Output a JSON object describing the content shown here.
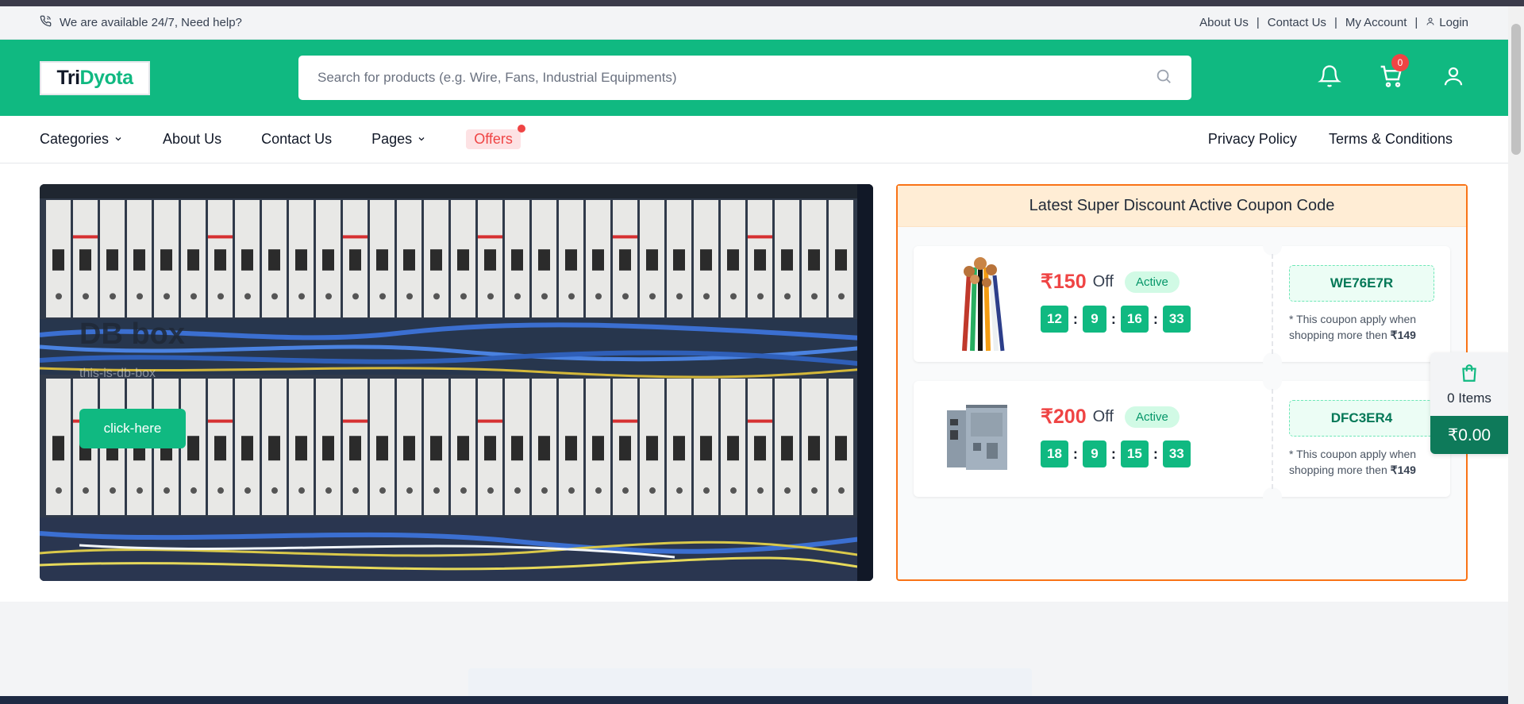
{
  "topbar": {
    "support_text": "We are available 24/7, Need help?",
    "links": [
      "About Us",
      "Contact Us",
      "My Account"
    ],
    "login": "Login"
  },
  "header": {
    "logo_part1": "Tri",
    "logo_part2": "Dyota",
    "search_placeholder": "Search for products (e.g. Wire, Fans, Industrial Equipments)",
    "cart_count": "0",
    "icons": [
      "bell-icon",
      "cart-icon",
      "user-icon"
    ]
  },
  "nav": {
    "categories": "Categories",
    "about": "About Us",
    "contact": "Contact Us",
    "pages": "Pages",
    "offers": "Offers",
    "privacy": "Privacy Policy",
    "terms": "Terms & Conditions"
  },
  "banner": {
    "title": "DB box",
    "subtitle": "this-is-db-box",
    "button": "click-here"
  },
  "coupons": {
    "heading": "Latest Super Discount Active Coupon Code",
    "items": [
      {
        "amount": "₹150",
        "off": "Off",
        "status": "Active",
        "timer": [
          "12",
          "9",
          "16",
          "33"
        ],
        "code": "WE76E7R",
        "note": "* This coupon apply when shopping more then",
        "min": "₹149"
      },
      {
        "amount": "₹200",
        "off": "Off",
        "status": "Active",
        "timer": [
          "18",
          "9",
          "15",
          "33"
        ],
        "code": "DFC3ER4",
        "note": "* This coupon apply when shopping more then",
        "min": "₹149"
      }
    ]
  },
  "cart_widget": {
    "items": "0 Items",
    "total": "₹0.00"
  },
  "colors": {
    "brand": "#10b981",
    "accent_red": "#ef4444",
    "coupon_border": "#f97316"
  }
}
